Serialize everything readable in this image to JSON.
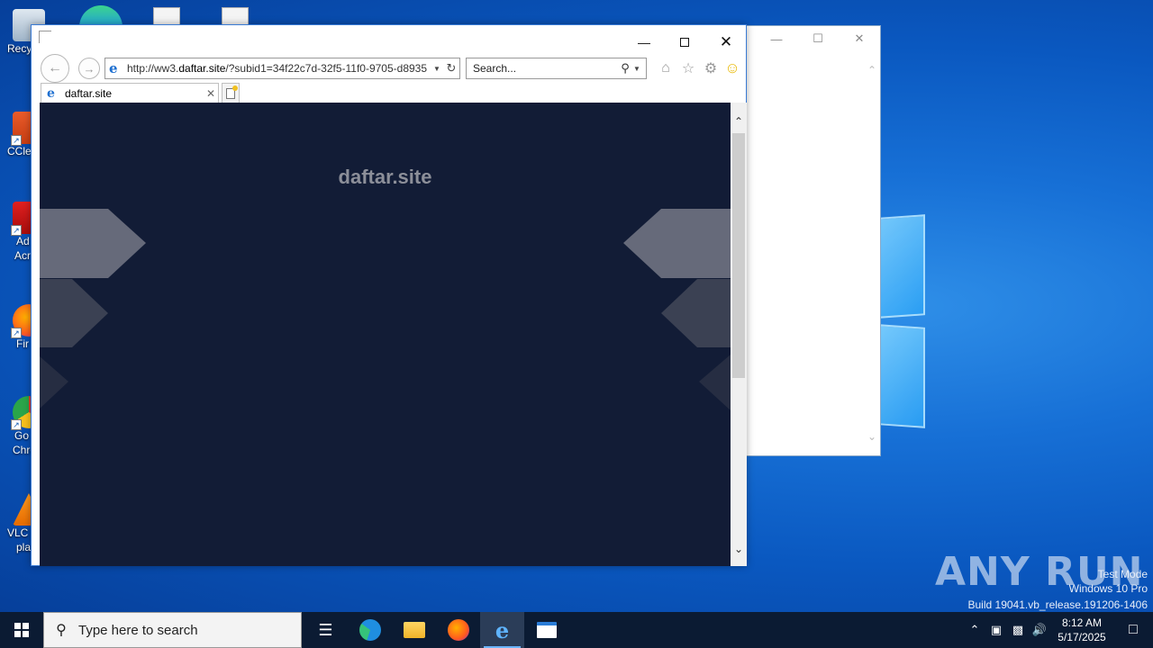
{
  "desktop": {
    "icons": [
      {
        "label": "Recy",
        "label2": ""
      },
      {
        "label": "CCle",
        "label2": ""
      },
      {
        "label": "Ad",
        "label2": "Acr"
      },
      {
        "label": "Fir",
        "label2": ""
      },
      {
        "label": "Go",
        "label2": "Chro"
      },
      {
        "label": "VLC m",
        "label2": "play"
      }
    ]
  },
  "browser": {
    "url_prefix": "http://ww3.",
    "url_domain": "daftar.site",
    "url_suffix": "/?subid1=34f22c7d-32f5-11f0-9705-d8935",
    "search_placeholder": "Search...",
    "tab_label": "daftar.site",
    "page_title": "daftar.site",
    "page_background": "#121c36",
    "accent": "#1e6fd0"
  },
  "watermark": {
    "brand": "ANY RUN",
    "line1": "Test Mode",
    "line2": "Windows 10 Pro",
    "line3": "Build 19041.vb_release.191206-1406"
  },
  "taskbar": {
    "search_placeholder": "Type here to search",
    "apps": [
      "task-view",
      "edge",
      "file-explorer",
      "firefox",
      "internet-explorer",
      "window-app"
    ],
    "time": "8:12 AM",
    "date": "5/17/2025"
  }
}
